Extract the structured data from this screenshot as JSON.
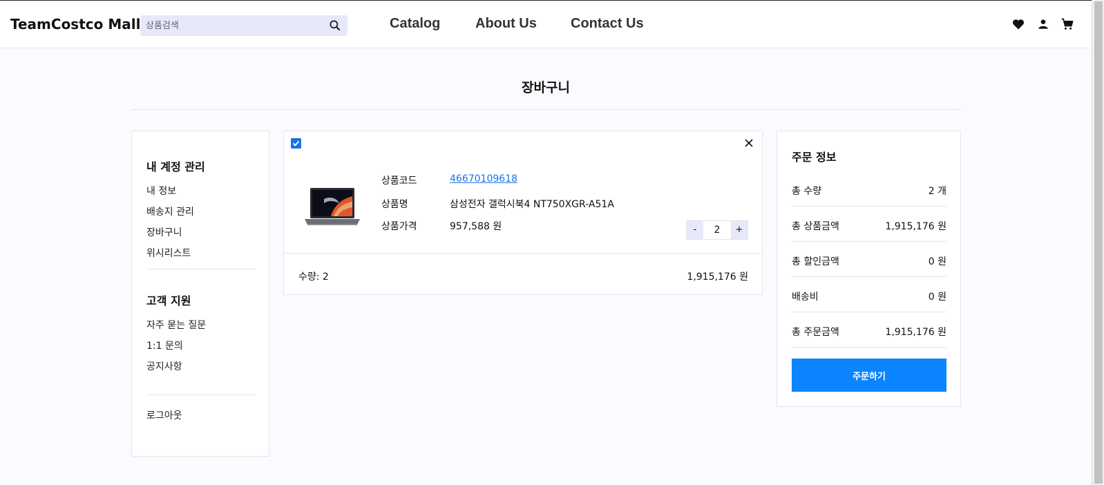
{
  "header": {
    "logo": "TeamCostco Mall",
    "search_placeholder": "상품검색",
    "nav": [
      "Catalog",
      "About Us",
      "Contact Us"
    ]
  },
  "page_title": "장바구니",
  "sidebar": {
    "account_heading": "내 계정 관리",
    "account_items": [
      "내 정보",
      "배송지 관리",
      "장바구니",
      "위시리스트"
    ],
    "support_heading": "고객 지원",
    "support_items": [
      "자주 묻는 질문",
      "1:1 문의",
      "공지사항"
    ],
    "logout": "로그아웃"
  },
  "cart_item": {
    "code_label": "상품코드",
    "code_value": "46670109618",
    "name_label": "상품명",
    "name_value": "삼성전자 갤럭시북4 NT750XGR-A51A",
    "price_label": "상품가격",
    "price_value": "957,588 원",
    "qty_minus": "-",
    "qty_value": "2",
    "qty_plus": "+",
    "footer_qty": "수량: 2",
    "footer_total": "1,915,176 원"
  },
  "order": {
    "title": "주문 정보",
    "rows": [
      {
        "k": "총 수량",
        "v": "2 개"
      },
      {
        "k": "총 상품금액",
        "v": "1,915,176 원"
      },
      {
        "k": "총 할인금액",
        "v": "0 원"
      },
      {
        "k": "배송비",
        "v": "0 원"
      },
      {
        "k": "총 주문금액",
        "v": "1,915,176 원"
      }
    ],
    "button": "주문하기"
  },
  "colors": {
    "accent": "#0a84ff",
    "link": "#1a73e8",
    "search_bg": "#e8e8fb",
    "page_bg": "#fafaff"
  }
}
